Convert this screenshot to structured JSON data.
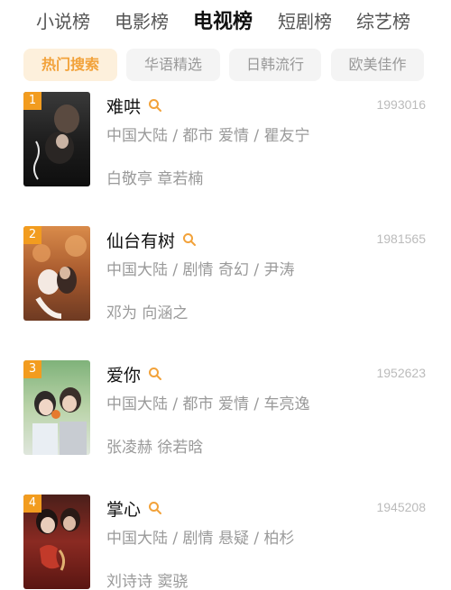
{
  "top_tabs": [
    {
      "label": "小说榜"
    },
    {
      "label": "电影榜"
    },
    {
      "label": "电视榜"
    },
    {
      "label": "短剧榜"
    },
    {
      "label": "综艺榜"
    }
  ],
  "active_top_tab": "电视榜",
  "chips": [
    {
      "label": "热门搜索"
    },
    {
      "label": "华语精选"
    },
    {
      "label": "日韩流行"
    },
    {
      "label": "欧美佳作"
    }
  ],
  "active_chip": "热门搜索",
  "colors": {
    "accent": "#f29c1f",
    "chip_active_bg": "#fdf0dc",
    "chip_active_text": "#f2a23a",
    "muted_text": "#9a9a9a"
  },
  "items": [
    {
      "rank": "1",
      "title": "难哄",
      "score": "1993016",
      "meta": "中国大陆 / 都市 爱情 / 瞿友宁",
      "cast": "白敬亭 章若楠",
      "poster_icon": "poster-image"
    },
    {
      "rank": "2",
      "title": "仙台有树",
      "score": "1981565",
      "meta": "中国大陆 / 剧情 奇幻 / 尹涛",
      "cast": "邓为 向涵之",
      "poster_icon": "poster-image"
    },
    {
      "rank": "3",
      "title": "爱你",
      "score": "1952623",
      "meta": "中国大陆 / 都市 爱情 / 车亮逸",
      "cast": "张凌赫 徐若晗",
      "poster_icon": "poster-image"
    },
    {
      "rank": "4",
      "title": "掌心",
      "score": "1945208",
      "meta": "中国大陆 / 剧情 悬疑 / 柏杉",
      "cast": "刘诗诗 窦骁",
      "poster_icon": "poster-image"
    }
  ]
}
